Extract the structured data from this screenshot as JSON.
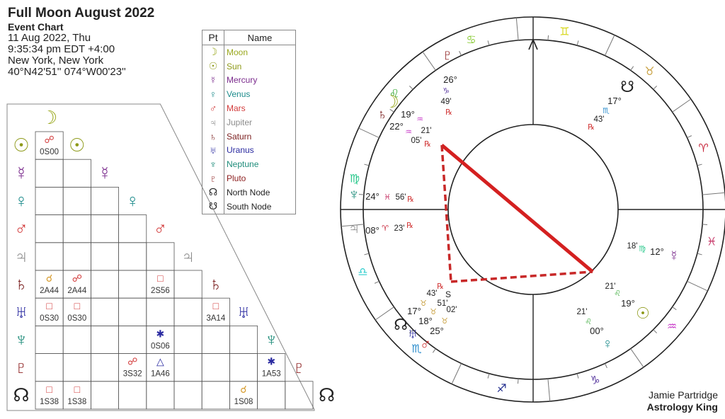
{
  "header": {
    "title": "Full Moon August 2022",
    "subtitle": "Event Chart",
    "date": "11 Aug 2022, Thu",
    "time": "9:35:34 pm  EDT +4:00",
    "location": "New York, New York",
    "coords": "40°N42'51'' 074°W00'23''"
  },
  "legend": {
    "col_pt": "Pt",
    "col_name": "Name",
    "rows": [
      {
        "glyph": "☽",
        "name": "Moon",
        "color": "#9aa81e"
      },
      {
        "glyph": "☉",
        "name": "Sun",
        "color": "#8e9a1a"
      },
      {
        "glyph": "☿",
        "name": "Mercury",
        "color": "#7a2a8c"
      },
      {
        "glyph": "♀",
        "name": "Venus",
        "color": "#1e8c8c"
      },
      {
        "glyph": "♂",
        "name": "Mars",
        "color": "#d23a3a"
      },
      {
        "glyph": "♃",
        "name": "Jupiter",
        "color": "#8c8c8c"
      },
      {
        "glyph": "♄",
        "name": "Saturn",
        "color": "#7a1e1e"
      },
      {
        "glyph": "♅",
        "name": "Uranus",
        "color": "#2a2aa0"
      },
      {
        "glyph": "♆",
        "name": "Neptune",
        "color": "#1e8c7a"
      },
      {
        "glyph": "♇",
        "name": "Pluto",
        "color": "#8c1e1e"
      },
      {
        "glyph": "☊",
        "name": "North Node",
        "color": "#222222"
      },
      {
        "glyph": "☋",
        "name": "South Node",
        "color": "#222222"
      }
    ]
  },
  "aspect_grid": {
    "planets": [
      {
        "glyph": "☽",
        "color": "#9aa81e"
      },
      {
        "glyph": "☉",
        "color": "#8e9a1a"
      },
      {
        "glyph": "☿",
        "color": "#7a2a8c"
      },
      {
        "glyph": "♀",
        "color": "#1e8c8c"
      },
      {
        "glyph": "♂",
        "color": "#d23a3a"
      },
      {
        "glyph": "♃",
        "color": "#8c8c8c"
      },
      {
        "glyph": "♄",
        "color": "#7a1e1e"
      },
      {
        "glyph": "♅",
        "color": "#2a2aa0"
      },
      {
        "glyph": "♆",
        "color": "#1e8c7a"
      },
      {
        "glyph": "♇",
        "color": "#8c1e1e"
      },
      {
        "glyph": "☊",
        "color": "#222222"
      }
    ],
    "aspects": [
      {
        "row": 1,
        "col": 0,
        "glyph": "☍",
        "color": "#d23a3a",
        "orb": "0S00"
      },
      {
        "row": 6,
        "col": 0,
        "glyph": "☌",
        "color": "#d69a2a",
        "orb": "2A44"
      },
      {
        "row": 6,
        "col": 1,
        "glyph": "☍",
        "color": "#d23a3a",
        "orb": "2A44"
      },
      {
        "row": 6,
        "col": 4,
        "glyph": "□",
        "color": "#d23a3a",
        "orb": "2S56"
      },
      {
        "row": 7,
        "col": 0,
        "glyph": "□",
        "color": "#d23a3a",
        "orb": "0S30"
      },
      {
        "row": 7,
        "col": 1,
        "glyph": "□",
        "color": "#d23a3a",
        "orb": "0S30"
      },
      {
        "row": 7,
        "col": 6,
        "glyph": "□",
        "color": "#d23a3a",
        "orb": "3A14"
      },
      {
        "row": 8,
        "col": 4,
        "glyph": "✱",
        "color": "#2a2aa0",
        "orb": "0S06"
      },
      {
        "row": 9,
        "col": 3,
        "glyph": "☍",
        "color": "#d23a3a",
        "orb": "3S32"
      },
      {
        "row": 9,
        "col": 4,
        "glyph": "△",
        "color": "#2a2aa0",
        "orb": "1A46"
      },
      {
        "row": 9,
        "col": 8,
        "glyph": "✱",
        "color": "#2a2aa0",
        "orb": "1A53"
      },
      {
        "row": 10,
        "col": 0,
        "glyph": "□",
        "color": "#d23a3a",
        "orb": "1S38"
      },
      {
        "row": 10,
        "col": 1,
        "glyph": "□",
        "color": "#d23a3a",
        "orb": "1S38"
      },
      {
        "row": 10,
        "col": 7,
        "glyph": "☌",
        "color": "#d69a2a",
        "orb": "1S08"
      }
    ]
  },
  "wheel": {
    "ascendant_sign_lon": 175,
    "signs": [
      {
        "glyph": "♈",
        "lon": 15,
        "color": "#c8283c"
      },
      {
        "glyph": "♉",
        "lon": 45,
        "color": "#c8a040"
      },
      {
        "glyph": "♊",
        "lon": 75,
        "color": "#d8d820"
      },
      {
        "glyph": "♋",
        "lon": 105,
        "color": "#8ccc3a"
      },
      {
        "glyph": "♌",
        "lon": 135,
        "color": "#3aaa3a"
      },
      {
        "glyph": "♍",
        "lon": 165,
        "color": "#2ac88c"
      },
      {
        "glyph": "♎",
        "lon": 195,
        "color": "#2acccc"
      },
      {
        "glyph": "♏",
        "lon": 225,
        "color": "#2a8ccc"
      },
      {
        "glyph": "♐",
        "lon": 255,
        "color": "#1e2a8c"
      },
      {
        "glyph": "♑",
        "lon": 285,
        "color": "#5a3aa0"
      },
      {
        "glyph": "♒",
        "lon": 315,
        "color": "#c83ac8"
      },
      {
        "glyph": "♓",
        "lon": 345,
        "color": "#c83a6a"
      }
    ],
    "planets": [
      {
        "name": "Pluto",
        "glyph": "♇",
        "color": "#8c1e1e",
        "deg": "26°",
        "sign": "♑",
        "sign_color": "#5a3aa0",
        "min": "49'",
        "retro": true
      },
      {
        "name": "Moon",
        "glyph": "☽",
        "color": "#9aa81e",
        "deg": "19°",
        "sign": "♒",
        "sign_color": "#c83ac8",
        "min": "21'",
        "retro": false
      },
      {
        "name": "Saturn",
        "glyph": "♄",
        "color": "#7a1e1e",
        "deg": "22°",
        "sign": "♒",
        "sign_color": "#c83ac8",
        "min": "05'",
        "retro": true
      },
      {
        "name": "Neptune",
        "glyph": "♆",
        "color": "#1e8c7a",
        "deg": "24°",
        "sign": "♓",
        "sign_color": "#c83a6a",
        "min": "56'",
        "retro": true
      },
      {
        "name": "Jupiter",
        "glyph": "♃",
        "color": "#8c8c8c",
        "deg": "08°",
        "sign": "♈",
        "sign_color": "#c8283c",
        "min": "23'",
        "retro": true
      },
      {
        "name": "North Node",
        "glyph": "☊",
        "color": "#222222",
        "deg": "17°",
        "sign": "♉",
        "sign_color": "#c8a040",
        "min": "43'",
        "retro": true
      },
      {
        "name": "Uranus",
        "glyph": "♅",
        "color": "#2a2aa0",
        "deg": "18°",
        "sign": "♉",
        "sign_color": "#c8a040",
        "min": "51'",
        "retro": false,
        "station": "S"
      },
      {
        "name": "Mars",
        "glyph": "♂",
        "color": "#d23a3a",
        "deg": "25°",
        "sign": "♉",
        "sign_color": "#c8a040",
        "min": "02'",
        "retro": false
      },
      {
        "name": "Venus",
        "glyph": "♀",
        "color": "#1e8c8c",
        "deg": "00°",
        "sign": "♌",
        "sign_color": "#3aaa3a",
        "min": "21'",
        "retro": false
      },
      {
        "name": "Sun",
        "glyph": "☉",
        "color": "#8e9a1a",
        "deg": "19°",
        "sign": "♌",
        "sign_color": "#3aaa3a",
        "min": "21'",
        "retro": false
      },
      {
        "name": "Mercury",
        "glyph": "☿",
        "color": "#7a2a8c",
        "deg": "12°",
        "sign": "♍",
        "sign_color": "#2ac88c",
        "min": "18'",
        "retro": false
      },
      {
        "name": "South Node",
        "glyph": "☋",
        "color": "#222222",
        "deg": "17°",
        "sign": "♏",
        "sign_color": "#2a8ccc",
        "min": "43'",
        "retro": true
      }
    ],
    "retro_glyph": "℞",
    "retro_color": "#d23a3a"
  },
  "credit": {
    "line1": "Jamie Partridge",
    "line2": "Astrology King"
  }
}
